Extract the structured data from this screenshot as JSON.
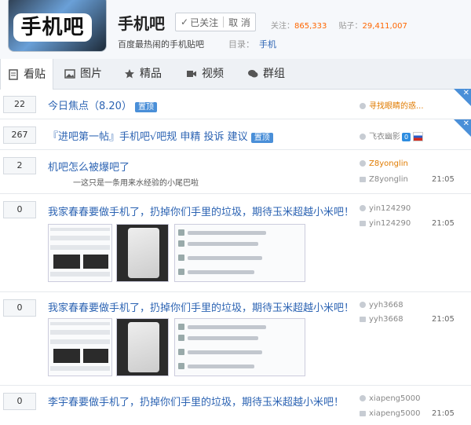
{
  "header": {
    "logo_text": "手机吧",
    "forum_title": "手机吧",
    "follow_label": "已关注",
    "unfollow_label": "取 消",
    "follow_label_key": "关注：",
    "follow_count": "865,333",
    "post_label_key": "贴子：",
    "post_count": "29,411,007",
    "slogan": "百度最热闹的手机贴吧",
    "category_key": "目录：",
    "category_value": "手机"
  },
  "tabs": [
    {
      "label": "看贴",
      "icon": "document-icon"
    },
    {
      "label": "图片",
      "icon": "image-icon"
    },
    {
      "label": "精品",
      "icon": "star-icon"
    },
    {
      "label": "视频",
      "icon": "video-icon"
    },
    {
      "label": "群组",
      "icon": "chat-icon"
    }
  ],
  "threads": [
    {
      "count": "22",
      "title": "今日焦点（8.20）",
      "tag": "置顶",
      "author": "寻找眼睛的惑...",
      "reply_author": "",
      "time": ""
    },
    {
      "count": "267",
      "title": "『进吧第一帖』手机吧√吧规 申精 投诉 建议",
      "tag": "置顶",
      "author": "飞衣幽影",
      "badge_num": "0",
      "reply_author": "",
      "time": ""
    },
    {
      "count": "2",
      "title": "机吧怎么被爆吧了",
      "sub": "一这只是一条用来水经验的小尾巴啦",
      "author": "Z8yonglin",
      "reply_author": "Z8yonglin",
      "time": "21:05"
    },
    {
      "count": "0",
      "title": "我家春春要做手机了，扔掉你们手里的垃圾，期待玉米超越小米吧！",
      "author": "yin124290",
      "reply_author": "yin124290",
      "time": "21:05"
    },
    {
      "count": "0",
      "title": "我家春春要做手机了，扔掉你们手里的垃圾，期待玉米超越小米吧！",
      "author": "yyh3668",
      "reply_author": "yyh3668",
      "time": "21:05"
    },
    {
      "count": "0",
      "title": "李宇春要做手机了，扔掉你们手里的垃圾，期待玉米超越小米吧！",
      "author": "xiapeng5000",
      "reply_author": "xiapeng5000",
      "time": "21:05"
    }
  ],
  "colors": {
    "link": "#2d64b3",
    "accent": "#4a8fd8",
    "count_highlight": "#ff6600"
  }
}
